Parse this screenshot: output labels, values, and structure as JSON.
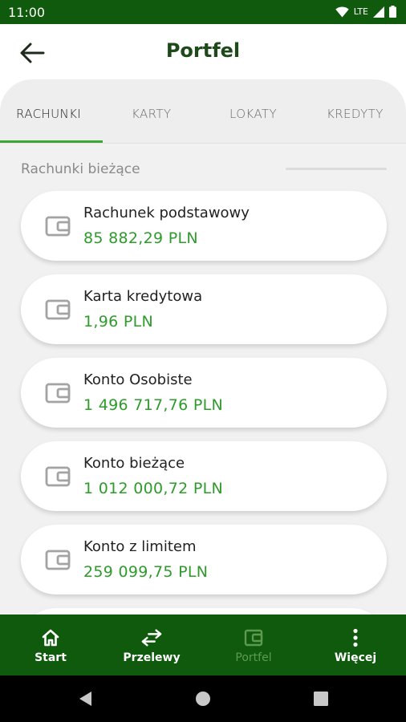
{
  "status_bar": {
    "time": "11:00",
    "network": "LTE"
  },
  "header": {
    "title": "Portfel",
    "back_icon": "arrow-left-icon"
  },
  "tabs": [
    {
      "label": "RACHUNKI",
      "active": true
    },
    {
      "label": "KARTY",
      "active": false
    },
    {
      "label": "LOKATY",
      "active": false
    },
    {
      "label": "KREDYTY",
      "active": false
    }
  ],
  "section": {
    "label": "Rachunki bieżące"
  },
  "accounts": [
    {
      "name": "Rachunek podstawowy",
      "amount": "85 882,29 PLN",
      "icon": "wallet-icon"
    },
    {
      "name": "Karta kredytowa",
      "amount": "1,96 PLN",
      "icon": "wallet-icon"
    },
    {
      "name": "Konto Osobiste",
      "amount": "1 496 717,76 PLN",
      "icon": "wallet-icon"
    },
    {
      "name": "Konto bieżące",
      "amount": "1 012 000,72 PLN",
      "icon": "wallet-icon"
    },
    {
      "name": "Konto z limitem",
      "amount": "259 099,75 PLN",
      "icon": "wallet-icon"
    }
  ],
  "bottom_nav": [
    {
      "label": "Start",
      "icon": "home-icon",
      "active": false
    },
    {
      "label": "Przelewy",
      "icon": "transfer-arrows-icon",
      "active": false
    },
    {
      "label": "Portfel",
      "icon": "wallet-icon",
      "active": true
    },
    {
      "label": "Więcej",
      "icon": "more-vertical-icon",
      "active": false
    }
  ],
  "colors": {
    "brand_dark_green": "#0f5a0c",
    "amount_green": "#2e9b2b",
    "tab_indicator": "#3aa832",
    "title_green": "#1e4a1a"
  }
}
